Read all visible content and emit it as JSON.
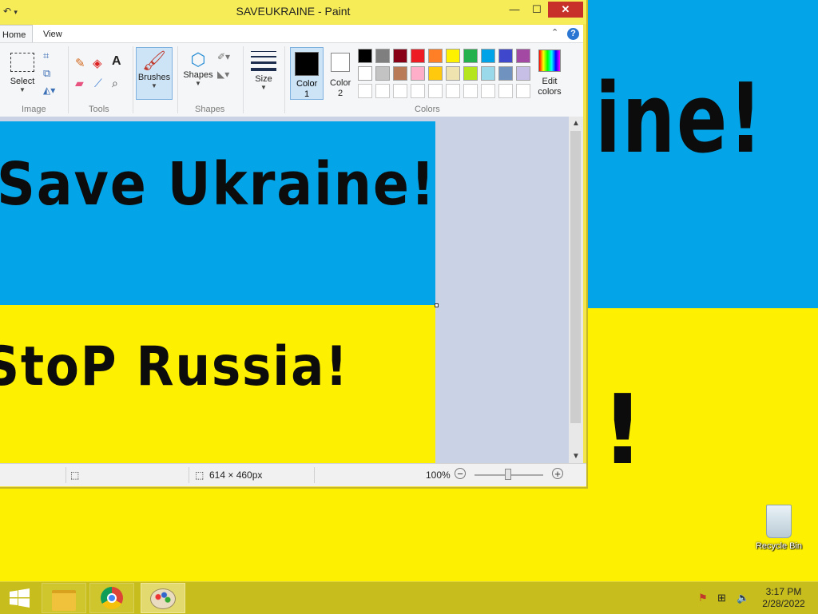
{
  "desktop": {
    "text_line1": "ine!",
    "text_exclaim": "!",
    "recycle_bin_label": "Recycle Bin"
  },
  "window": {
    "title": "SAVEUKRAINE - Paint",
    "minimize": "—",
    "maximize": "☐",
    "close": "✕"
  },
  "ribbon": {
    "tabs": [
      "Home",
      "View"
    ],
    "groups": {
      "image": {
        "label": "Image",
        "select": "Select"
      },
      "tools": {
        "label": "Tools"
      },
      "brushes": {
        "label": "Brushes"
      },
      "shapes": {
        "label": "Shapes",
        "shapes_btn": "Shapes"
      },
      "size": {
        "label": "Size"
      },
      "colors": {
        "label": "Colors",
        "color1": "Color 1",
        "color2": "Color 2",
        "edit_colors": "Edit colors"
      }
    },
    "palette_row1": [
      "#000000",
      "#7f7f7f",
      "#880015",
      "#ed1c24",
      "#ff7f27",
      "#fff200",
      "#22b14c",
      "#00a2e8",
      "#3f48cc",
      "#a349a4"
    ],
    "palette_row2": [
      "#ffffff",
      "#c3c3c3",
      "#b97a57",
      "#ffaec9",
      "#ffc90e",
      "#efe4b0",
      "#b5e61d",
      "#99d9ea",
      "#7092be",
      "#c8bfe7"
    ],
    "color1_value": "#000000",
    "color2_value": "#ffffff"
  },
  "canvas": {
    "line1": "Save Ukraine!",
    "line2": "StoP Russia!"
  },
  "statusbar": {
    "dimensions": "614 × 460px",
    "zoom": "100%"
  },
  "taskbar": {
    "time": "3:17 PM",
    "date": "2/28/2022"
  }
}
